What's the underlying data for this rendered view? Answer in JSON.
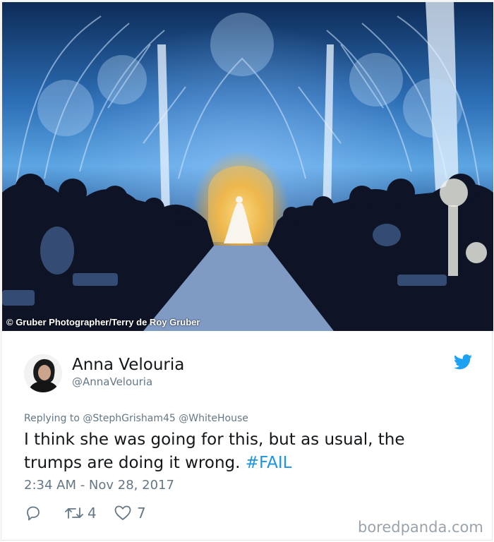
{
  "photo": {
    "credit": "© Gruber Photographer/Terry de Roy Gruber"
  },
  "tweet": {
    "display_name": "Anna Velouria",
    "handle": "@AnnaVelouria",
    "replying_label": "Replying to",
    "reply_mentions": [
      "@StephGrisham45",
      "@WhiteHouse"
    ],
    "text_line1": "I think she was going for this, but as usual, the",
    "text_line2_prefix": "trumps are doing it wrong.",
    "hashtag": "#FAIL",
    "timestamp": "2:34 AM - Nov 28, 2017",
    "retweet_count": "4",
    "like_count": "7"
  },
  "colors": {
    "accent": "#1b95e0",
    "secondary_text": "#657786"
  },
  "icons": [
    "reply-icon",
    "retweet-icon",
    "heart-icon",
    "twitter-bird-icon"
  ],
  "watermark": "boredpanda.com"
}
